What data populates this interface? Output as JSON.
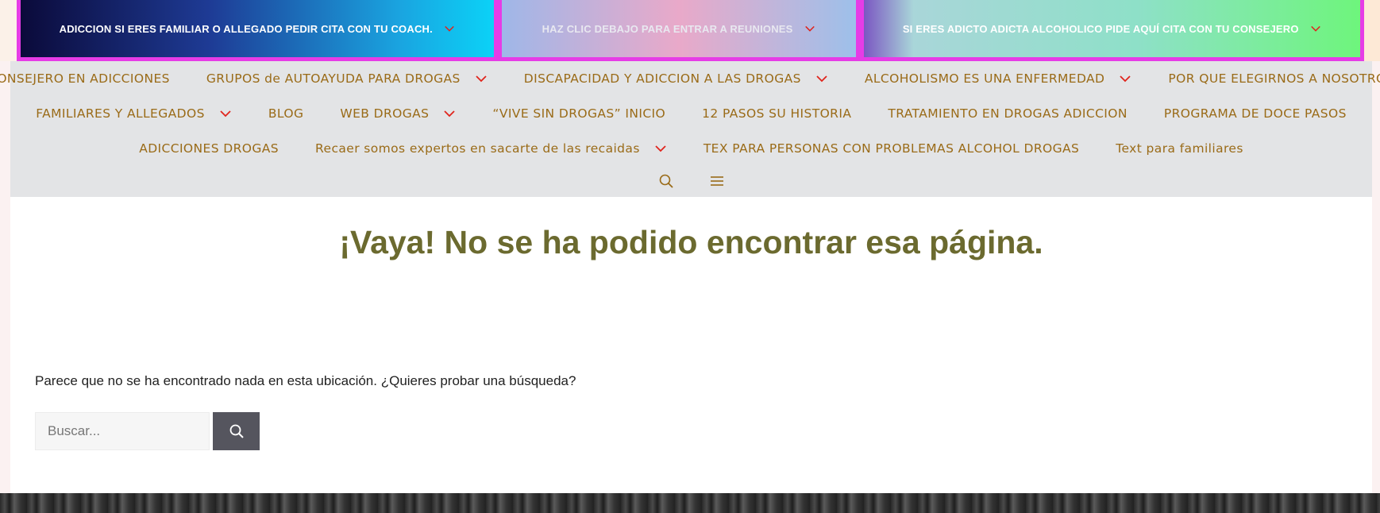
{
  "promos": [
    {
      "label": "ADICCION SI ERES FAMILIAR O ALLEGADO PEDIR CITA CON TU COACH."
    },
    {
      "label": "HAZ CLIC DEBAJO PARA ENTRAR A REUNIONES"
    },
    {
      "label": "SI ERES ADICTO ADICTA ALCOHOLICO PIDE AQUÍ CITA CON TU CONSEJERO"
    }
  ],
  "nav": {
    "row1": [
      {
        "label": "CONSEJERO EN ADICCIONES",
        "dropdown": false
      },
      {
        "label": "GRUPOS de AUTOAYUDA PARA DROGAS",
        "dropdown": true
      },
      {
        "label": "DISCAPACIDAD Y ADICCION A LAS DROGAS",
        "dropdown": true
      },
      {
        "label": "ALCOHOLISMO ES UNA ENFERMEDAD",
        "dropdown": true
      },
      {
        "label": "POR QUE ELEGIRNOS A NOSOTROS",
        "dropdown": false
      }
    ],
    "row2": [
      {
        "label": "FAMILIARES Y ALLEGADOS",
        "dropdown": true
      },
      {
        "label": "BLOG",
        "dropdown": false
      },
      {
        "label": "WEB DROGAS",
        "dropdown": true
      },
      {
        "label": "“VIVE SIN DROGAS” INICIO",
        "dropdown": false
      },
      {
        "label": "12 PASOS SU HISTORIA",
        "dropdown": false
      },
      {
        "label": "TRATAMIENTO EN DROGAS ADICCION",
        "dropdown": false
      },
      {
        "label": "PROGRAMA DE DOCE PASOS",
        "dropdown": false
      }
    ],
    "row3": [
      {
        "label": "ADICCIONES DROGAS",
        "dropdown": false
      },
      {
        "label": "Recaer somos expertos en sacarte de las recaidas",
        "dropdown": true
      },
      {
        "label": "TEX PARA PERSONAS CON PROBLEMAS ALCOHOL DROGAS",
        "dropdown": false
      },
      {
        "label": "Text para familiares",
        "dropdown": false
      }
    ],
    "icons": [
      "search-icon",
      "menu-icon"
    ]
  },
  "colors": {
    "nav_text": "#9a6b18",
    "chevron": "#e0241c",
    "title": "#6b6a2f",
    "promo_border": "#e63ce6"
  },
  "main": {
    "title": "¡Vaya! No se ha podido encontrar esa página.",
    "message": "Parece que no se ha encontrado nada en esta ubicación. ¿Quieres probar una búsqueda?",
    "search_placeholder": "Buscar..."
  }
}
